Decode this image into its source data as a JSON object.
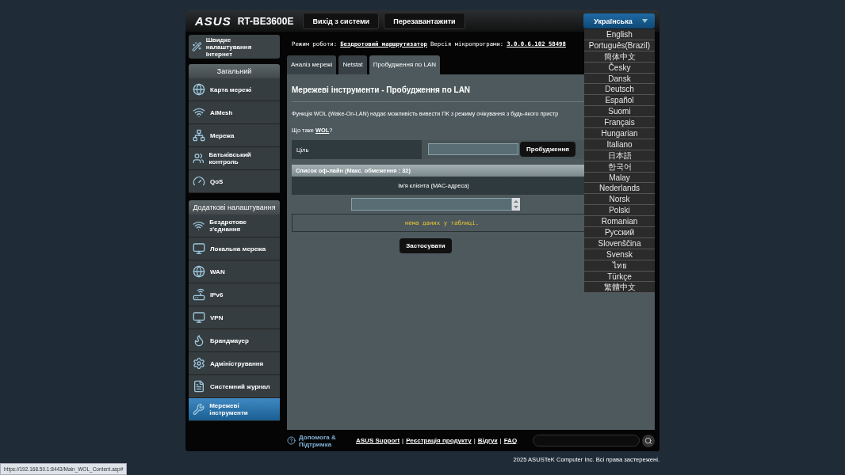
{
  "header": {
    "logo": "ASUS",
    "model": "RT-BE3600E",
    "buttons": [
      "Вихід з системи",
      "Перезавантажити"
    ],
    "language": {
      "current": "Українська",
      "expanded": true,
      "options": [
        {
          "label": "English"
        },
        {
          "label": "Português(Brazil)"
        },
        {
          "label": "簡体中文"
        },
        {
          "label": "Česky"
        },
        {
          "label": "Dansk"
        },
        {
          "label": "Deutsch"
        },
        {
          "label": "Español"
        },
        {
          "label": "Suomi"
        },
        {
          "label": "Français"
        },
        {
          "label": "Hungarian"
        },
        {
          "label": "Italiano"
        },
        {
          "label": "日本語"
        },
        {
          "label": "한국어"
        },
        {
          "label": "Malay"
        },
        {
          "label": "Nederlands"
        },
        {
          "label": "Norsk"
        },
        {
          "label": "Polski"
        },
        {
          "label": "Romanian"
        },
        {
          "label": "Русский"
        },
        {
          "label": "Slovenščina"
        },
        {
          "label": "Svensk"
        },
        {
          "label": "ไทย"
        },
        {
          "label": "Türkçe"
        },
        {
          "label": "繁體中文"
        }
      ]
    }
  },
  "sidebar": {
    "quick_setup": "Швидке налаштування Інтернет",
    "sections": [
      {
        "title": "Загальний",
        "items": [
          {
            "label": "Карта мережі",
            "selected": false
          },
          {
            "label": "AiMesh",
            "selected": false
          },
          {
            "label": "Мережа",
            "selected": false
          },
          {
            "label": "Батьківський контроль",
            "selected": false
          },
          {
            "label": "QoS",
            "selected": false
          }
        ]
      },
      {
        "title": "Додаткові налаштування",
        "items": [
          {
            "label": "Бездротове з'єднання",
            "selected": false
          },
          {
            "label": "Локальна мережа",
            "selected": false
          },
          {
            "label": "WAN",
            "selected": false
          },
          {
            "label": "IPv6",
            "selected": false
          },
          {
            "label": "VPN",
            "selected": false
          },
          {
            "label": "Брандмауер",
            "selected": false
          },
          {
            "label": "Адміністрування",
            "selected": false
          },
          {
            "label": "Системний журнал",
            "selected": false
          },
          {
            "label": "Мережеві інструменти",
            "selected": true
          }
        ]
      }
    ]
  },
  "info": {
    "mode_label": "Режим роботи:",
    "mode": "Бездротовий маршрутизатор",
    "firmware_label": "Версія мікропрограми:",
    "firmware": "3.0.0.6.102_58498"
  },
  "tabs": [
    {
      "label": "Аналіз мережі",
      "selected": false
    },
    {
      "label": "Netstat",
      "selected": false
    },
    {
      "label": "Пробудження по LAN",
      "selected": true
    }
  ],
  "panel": {
    "title": "Мережеві інструменти - Пробудження по LAN",
    "description": "Функція WOL (Wake-On-LAN) надає можливість вивести ПК з режиму очікування з будь-якого пристр",
    "question": {
      "prefix": "Що таке ",
      "link": "WOL",
      "suffix": "?"
    },
    "target": {
      "label": "Ціль",
      "button": "Пробудження"
    },
    "offline_list": {
      "title": "Список оф-лайн (Макс. обмеження : 32)",
      "column": "Ім'я клієнта (MAC-адреса)",
      "empty_text": "нема даних у таблиці."
    },
    "apply_button": "Застосувати"
  },
  "footer": {
    "help": "Допомога & Підтримка",
    "links": [
      "ASUS Support",
      "Реєстрація продукту",
      "Відгук",
      "FAQ"
    ],
    "separator": "|",
    "copyright": "2025 ASUSTeK Computer Inc. Всі права застережені."
  },
  "status_url": "https://192.168.50.1:8443/Main_WOL_Content.asp#"
}
